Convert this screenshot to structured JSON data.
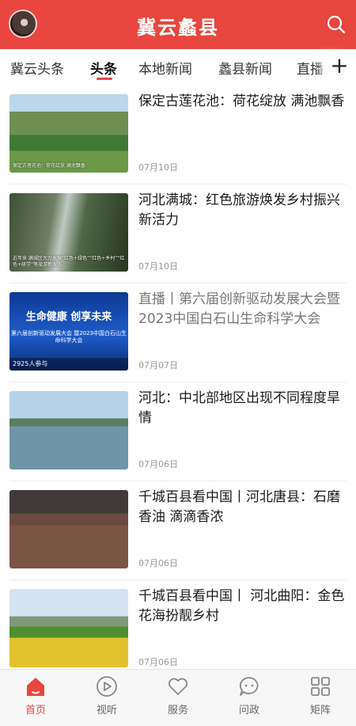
{
  "header": {
    "title": "冀云蠡县",
    "avatar_icon": "channel-avatar",
    "search_icon": "search-icon",
    "brand_color": "#e8463e"
  },
  "tabs": [
    {
      "label": "冀云头条",
      "active": false
    },
    {
      "label": "头条",
      "active": true
    },
    {
      "label": "本地新闻",
      "active": false
    },
    {
      "label": "蠡县新闻",
      "active": false
    },
    {
      "label": "直播",
      "active": false
    }
  ],
  "add_channel_label": "+",
  "news": [
    {
      "title": "保定古莲花池：荷花绽放 满池飘香",
      "date": "07月10日",
      "thumb_caption": "保定古莲花池：荷花绽放 满池飘香"
    },
    {
      "title": "河北满城：红色旅游焕发乡村振兴新活力",
      "date": "07月10日",
      "thumb_caption": "近年来 满城区大力发展“红色+绿色”“红色+乡村”“红色+研学”等旅游新业态"
    },
    {
      "title": "直播丨第六届创新驱动发展大会暨2023中国白石山生命科学大会",
      "date": "07月07日",
      "thumb_banner": "生命健康 创享未来",
      "thumb_subtitle": "第六届创新驱动发展大会 暨2023中国白石山生命科学大会",
      "play_count": "2925人参与"
    },
    {
      "title": "河北：中北部地区出现不同程度旱情",
      "date": "07月06日"
    },
    {
      "title": "千城百县看中国丨河北唐县：石磨香油 滴滴香浓",
      "date": "07月06日"
    },
    {
      "title": "千城百县看中国丨 河北曲阳：金色花海扮靓乡村",
      "date": "07月06日"
    }
  ],
  "bottom_nav": [
    {
      "label": "首页",
      "icon": "home-icon",
      "active": true
    },
    {
      "label": "视听",
      "icon": "play-icon",
      "active": false
    },
    {
      "label": "服务",
      "icon": "heart-icon",
      "active": false
    },
    {
      "label": "问政",
      "icon": "chat-icon",
      "active": false
    },
    {
      "label": "矩阵",
      "icon": "grid-icon",
      "active": false
    }
  ]
}
